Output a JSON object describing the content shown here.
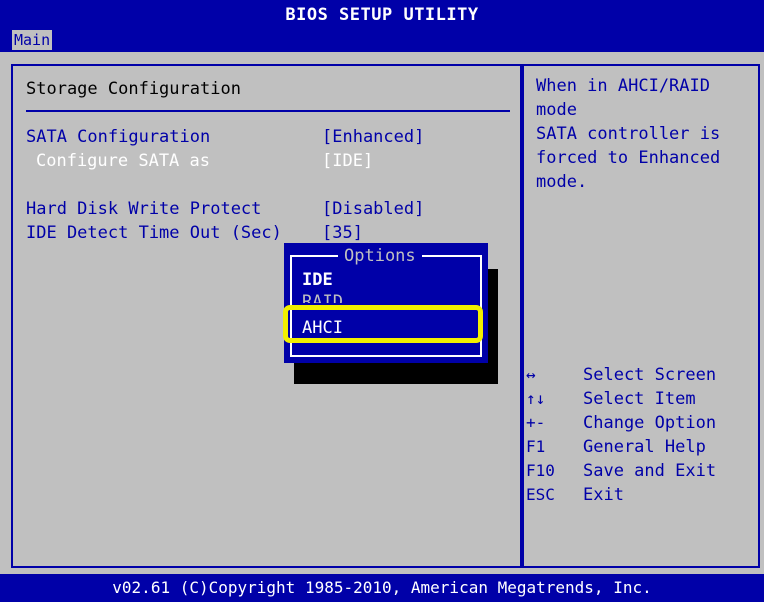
{
  "window": {
    "title": "BIOS SETUP UTILITY"
  },
  "menu": {
    "active_tab": "Main"
  },
  "section": {
    "title": "Storage Configuration"
  },
  "settings": [
    {
      "label": "SATA Configuration",
      "value": "[Enhanced]"
    },
    {
      "label": "Configure SATA as",
      "value": "[IDE]"
    },
    {
      "label": "Hard Disk Write Protect",
      "value": "[Disabled]"
    },
    {
      "label": "IDE Detect Time Out (Sec)",
      "value": "[35]"
    }
  ],
  "help": {
    "text": "When in AHCI/RAID mode\nSATA controller is\nforced to Enhanced\nmode."
  },
  "keys": [
    {
      "key": "↔",
      "desc": "Select Screen"
    },
    {
      "key": "↑↓",
      "desc": "Select Item"
    },
    {
      "key": "+-",
      "desc": "Change Option"
    },
    {
      "key": "F1",
      "desc": "General Help"
    },
    {
      "key": "F10",
      "desc": "Save and Exit"
    },
    {
      "key": "ESC",
      "desc": "Exit"
    }
  ],
  "popup": {
    "title": "Options",
    "options": [
      "IDE",
      "RAID",
      "AHCI"
    ],
    "selected": "AHCI"
  },
  "footer": {
    "text": "v02.61 (C)Copyright 1985-2010, American Megatrends, Inc."
  },
  "colors": {
    "background_blue": "#0000a8",
    "panel_gray": "#c0c0c0",
    "highlight_yellow": "#f2f000",
    "text_white": "#ffffff"
  }
}
